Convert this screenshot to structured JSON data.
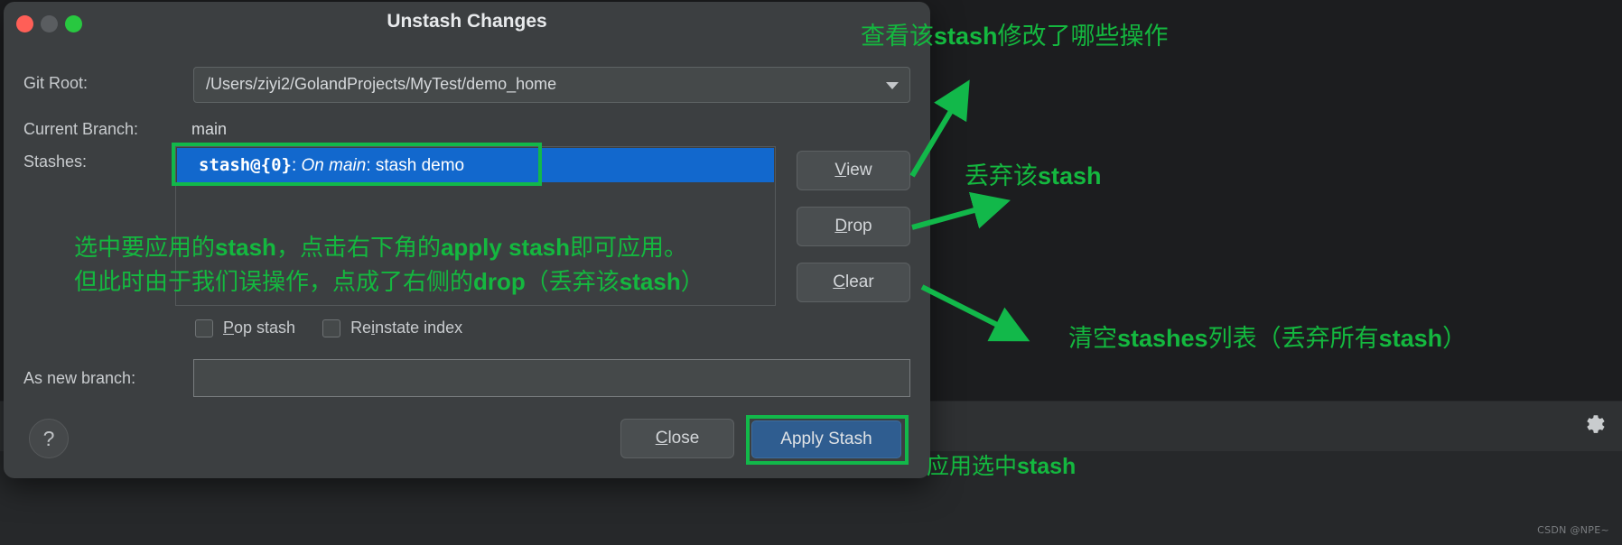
{
  "dialog": {
    "title": "Unstash Changes",
    "traffic_lights": [
      "close",
      "minimize",
      "maximize"
    ],
    "git_root": {
      "label": "Git Root:",
      "value": "/Users/ziyi2/GolandProjects/MyTest/demo_home"
    },
    "current_branch": {
      "label": "Current Branch:",
      "value": "main"
    },
    "stashes": {
      "label": "Stashes:",
      "items": [
        {
          "id": "stash@{0}",
          "separator1": ": ",
          "on": "On main",
          "separator2": ": ",
          "message": "stash demo",
          "selected": true
        }
      ]
    },
    "side_buttons": [
      {
        "name": "view",
        "mnemonic": "V",
        "rest": "iew"
      },
      {
        "name": "drop",
        "mnemonic": "D",
        "rest": "rop"
      },
      {
        "name": "clear",
        "mnemonic": "C",
        "rest": "lear"
      }
    ],
    "checkboxes": [
      {
        "name": "pop-stash",
        "pre": "",
        "mnemonic": "P",
        "post": "op stash",
        "checked": false
      },
      {
        "name": "reinstate-index",
        "pre": "Re",
        "mnemonic": "i",
        "post": "nstate index",
        "checked": false
      }
    ],
    "as_new_branch": {
      "label": "As new branch:",
      "value": "",
      "placeholder": ""
    },
    "help_button": "?",
    "footer_buttons": {
      "close": {
        "mnemonic": "C",
        "rest": "lose"
      },
      "apply": {
        "label": "Apply Stash",
        "primary": true
      }
    }
  },
  "annotations": {
    "view": {
      "pre": "查看该",
      "bold": "stash",
      "post": "修改了哪些操作"
    },
    "drop": {
      "pre": "丢弃该",
      "bold": "stash",
      "post": ""
    },
    "clear": {
      "pre": "清空",
      "bold": "stashes",
      "mid": "列表（丢弃所有",
      "bold2": "stash",
      "post": "）"
    },
    "apply": {
      "pre": "应用选中",
      "bold": "stash",
      "post": ""
    },
    "select_line1": {
      "pre": "选中要应用的",
      "bold": "stash",
      "mid": "，点击右下角的",
      "bold2": "apply stash",
      "post": "即可应用。"
    },
    "select_line2": {
      "pre": "但此时由于我们误操作，点成了右侧的",
      "bold": "drop",
      "mid": "（丢弃该",
      "bold2": "stash",
      "post": "）"
    }
  },
  "background": {
    "gear_icon": "gear-icon",
    "watermark": "CSDN @NPE~"
  },
  "colors": {
    "accent_green": "#12b84a",
    "selection_blue": "#1268cd",
    "primary_button": "#2f5d90",
    "dialog_bg": "#3c3f41",
    "text": "#c8cbce"
  }
}
